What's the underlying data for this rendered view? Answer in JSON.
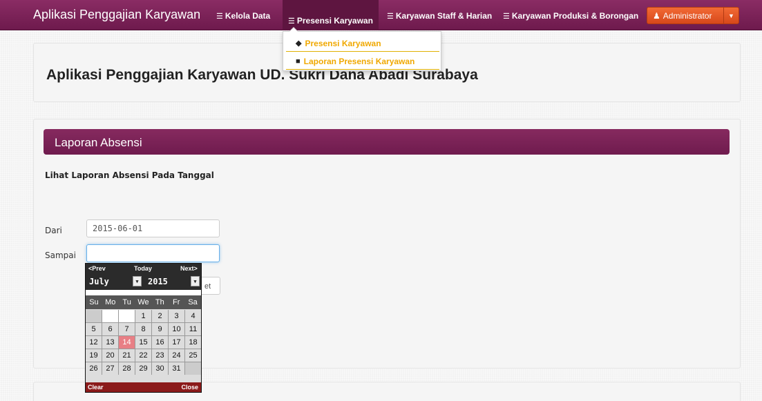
{
  "navbar": {
    "brand": "Aplikasi Penggajian Karyawan",
    "items": [
      {
        "label": "Kelola Data"
      },
      {
        "label": "Presensi Karyawan"
      },
      {
        "label": "Karyawan Staff & Harian"
      },
      {
        "label": "Karyawan Produksi & Borongan"
      }
    ],
    "user": "Administrator"
  },
  "dropdown": {
    "items": [
      {
        "label": "Presensi Karyawan"
      },
      {
        "label": "Laporan Presensi Karyawan"
      }
    ]
  },
  "hero": {
    "title": "Aplikasi Penggajian Karyawan UD. Sukri Dana Abadi Surabaya"
  },
  "panel": {
    "heading": "Laporan Absensi",
    "subtitle": "Lihat Laporan Absensi Pada Tanggal",
    "from_label": "Dari",
    "from_value": "2015-06-01",
    "to_label": "Sampai",
    "to_value": "",
    "button_partial": "et"
  },
  "calendar": {
    "prev": "<Prev",
    "today": "Today",
    "next": "Next>",
    "month": "July",
    "year": "2015",
    "weekdays": [
      "Su",
      "Mo",
      "Tu",
      "We",
      "Th",
      "Fr",
      "Sa"
    ],
    "weeks": [
      [
        "",
        "",
        "",
        "1",
        "2",
        "3",
        "4"
      ],
      [
        "5",
        "6",
        "7",
        "8",
        "9",
        "10",
        "11"
      ],
      [
        "12",
        "13",
        "14",
        "15",
        "16",
        "17",
        "18"
      ],
      [
        "19",
        "20",
        "21",
        "22",
        "23",
        "24",
        "25"
      ],
      [
        "26",
        "27",
        "28",
        "29",
        "30",
        "31",
        ""
      ]
    ],
    "highlighted_day": "14",
    "clear": "Clear",
    "close": "Close"
  },
  "colors": {
    "navbar": "#7a2157",
    "accent": "#f0a800",
    "admin": "#e4582a",
    "today": "#e87f85"
  }
}
